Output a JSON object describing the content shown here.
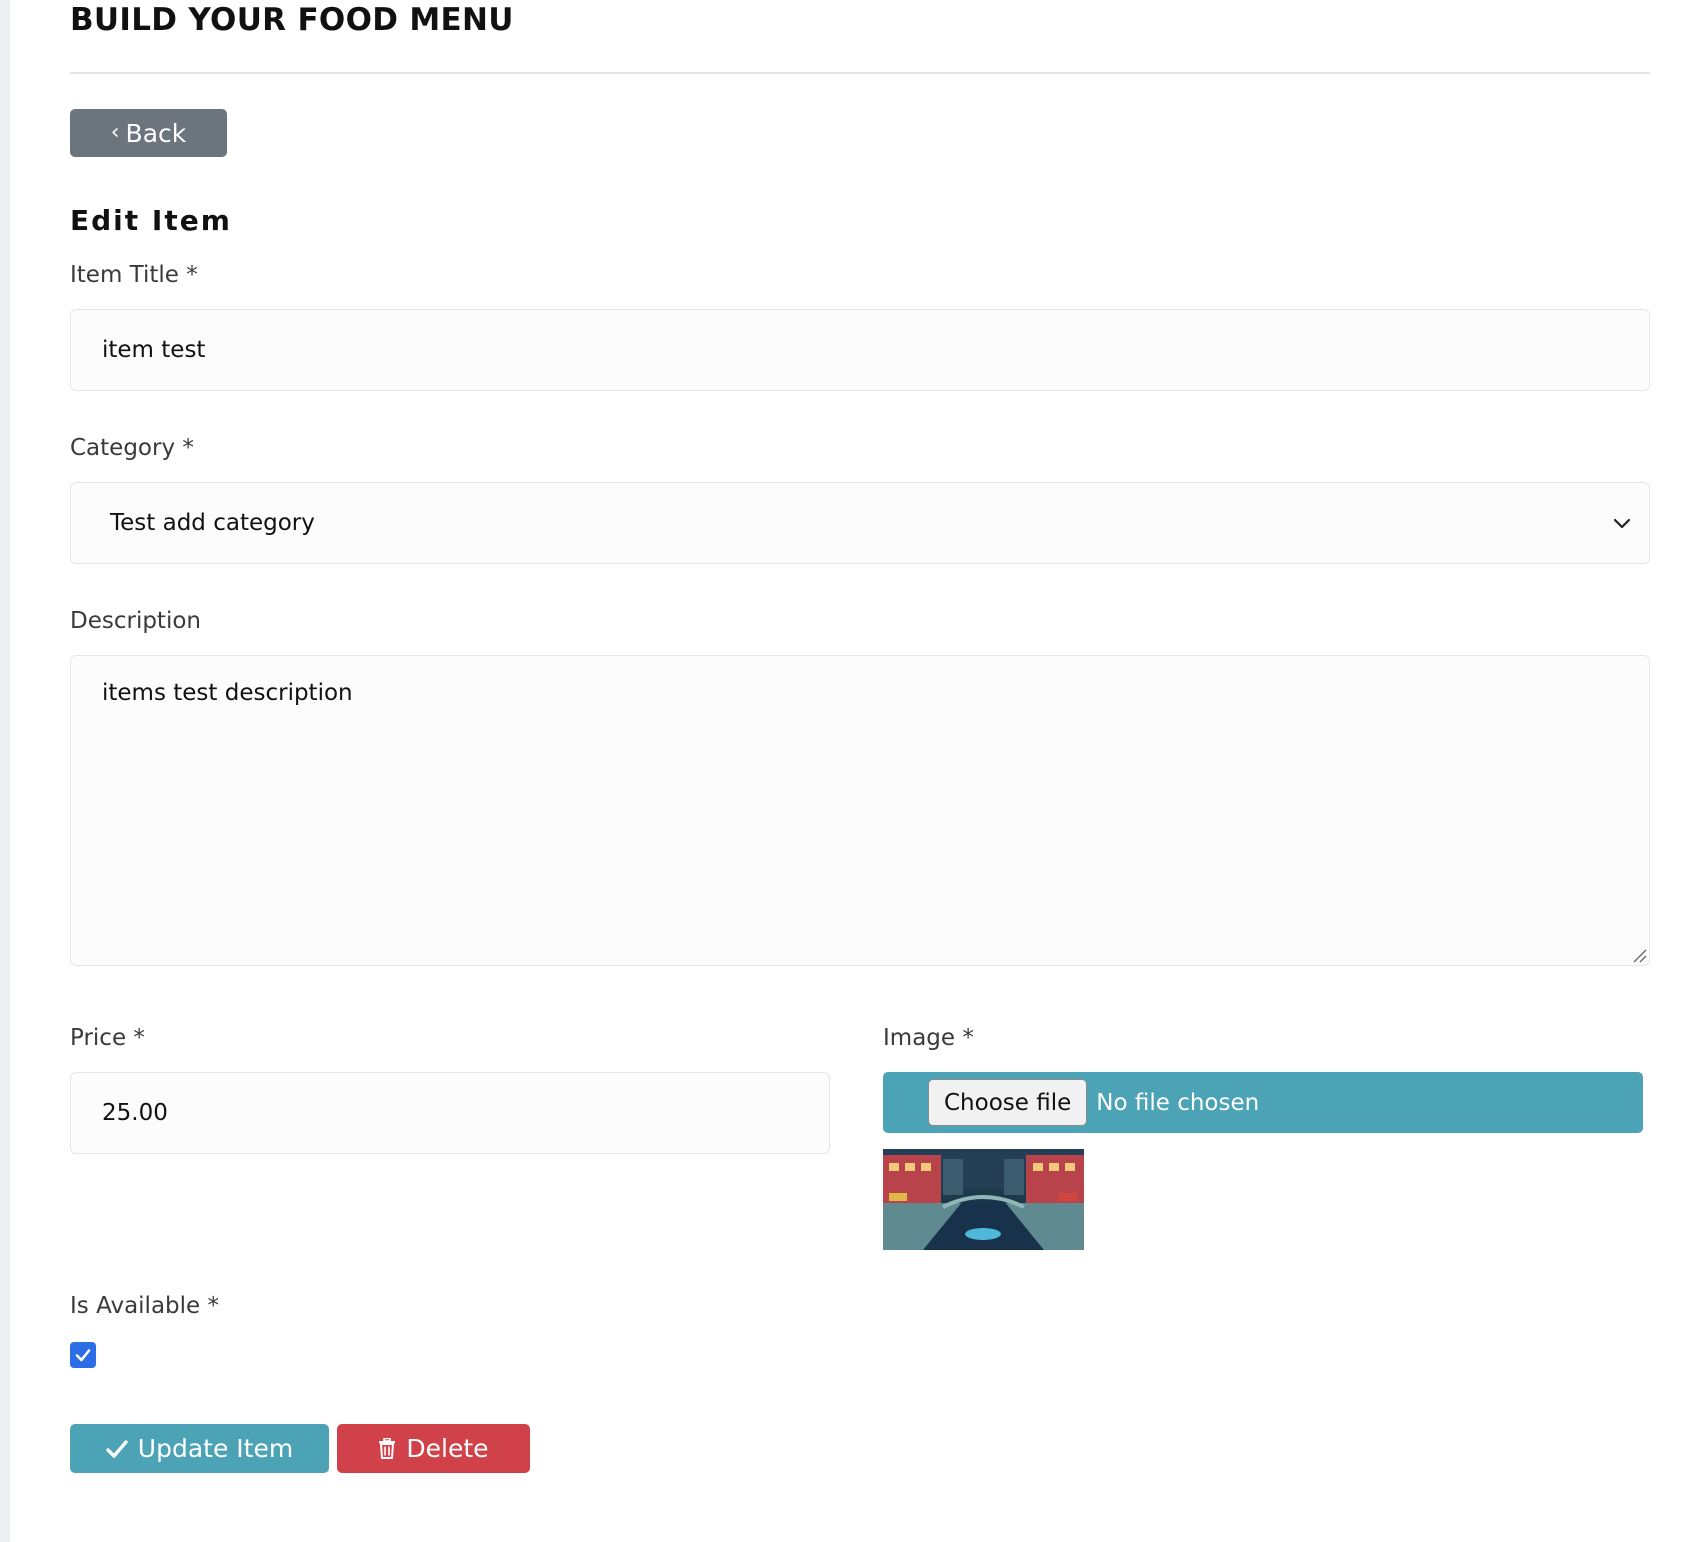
{
  "page": {
    "title": "BUILD YOUR FOOD MENU"
  },
  "toolbar": {
    "back_label": "Back"
  },
  "form": {
    "heading": "Edit Item",
    "item_title": {
      "label": "Item Title *",
      "value": "item test"
    },
    "category": {
      "label": "Category *",
      "selected": "Test add category"
    },
    "description": {
      "label": "Description",
      "value": "items test description"
    },
    "price": {
      "label": "Price *",
      "value": "25.00"
    },
    "image": {
      "label": "Image *",
      "choose_label": "Choose file",
      "status": "No file chosen"
    },
    "is_available": {
      "label": "Is Available *",
      "checked": true
    }
  },
  "actions": {
    "update_label": "Update Item",
    "delete_label": "Delete"
  },
  "colors": {
    "back_button": "#6c757d",
    "accent_teal": "#4ba3b5",
    "danger": "#d04149",
    "checkbox": "#2a6de5"
  },
  "icons": [
    "chevron-left-icon",
    "chevron-down-icon",
    "check-icon",
    "trash-icon"
  ]
}
